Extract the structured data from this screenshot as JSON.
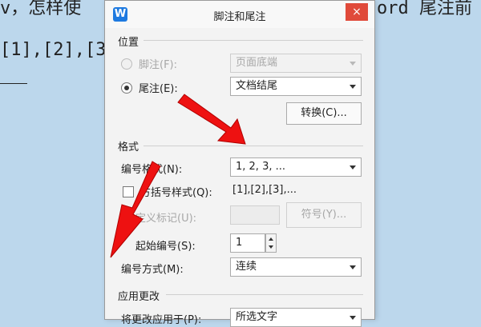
{
  "background": {
    "line1_left": "v，怎样使",
    "line1_right": "ord 尾注前",
    "line2": "[1],[2],[3"
  },
  "dialog": {
    "app_icon": "W",
    "title": "脚注和尾注",
    "close_icon": "×",
    "position": {
      "heading": "位置",
      "footnote_label": "脚注(F):",
      "footnote_value": "页面底端",
      "endnote_label": "尾注(E):",
      "endnote_value": "文档结尾",
      "convert_button": "转换(C)..."
    },
    "format": {
      "heading": "格式",
      "number_format_label": "编号格式(N):",
      "number_format_value": "1, 2, 3, ...",
      "bracket_label": "方括号样式(Q):",
      "bracket_example": "[1],[2],[3],...",
      "custom_mark_label": "定义标记(U):",
      "symbol_button": "符号(Y)...",
      "start_number_label": "起始编号(S):",
      "start_number_value": "1",
      "numbering_label": "编号方式(M):",
      "numbering_value": "连续"
    },
    "apply": {
      "heading": "应用更改",
      "apply_to_label": "将更改应用于(P):",
      "apply_to_value": "所选文字"
    }
  },
  "colors": {
    "arrow": "#ee1111",
    "close": "#e04a3a",
    "app_icon": "#1e7ae0"
  }
}
